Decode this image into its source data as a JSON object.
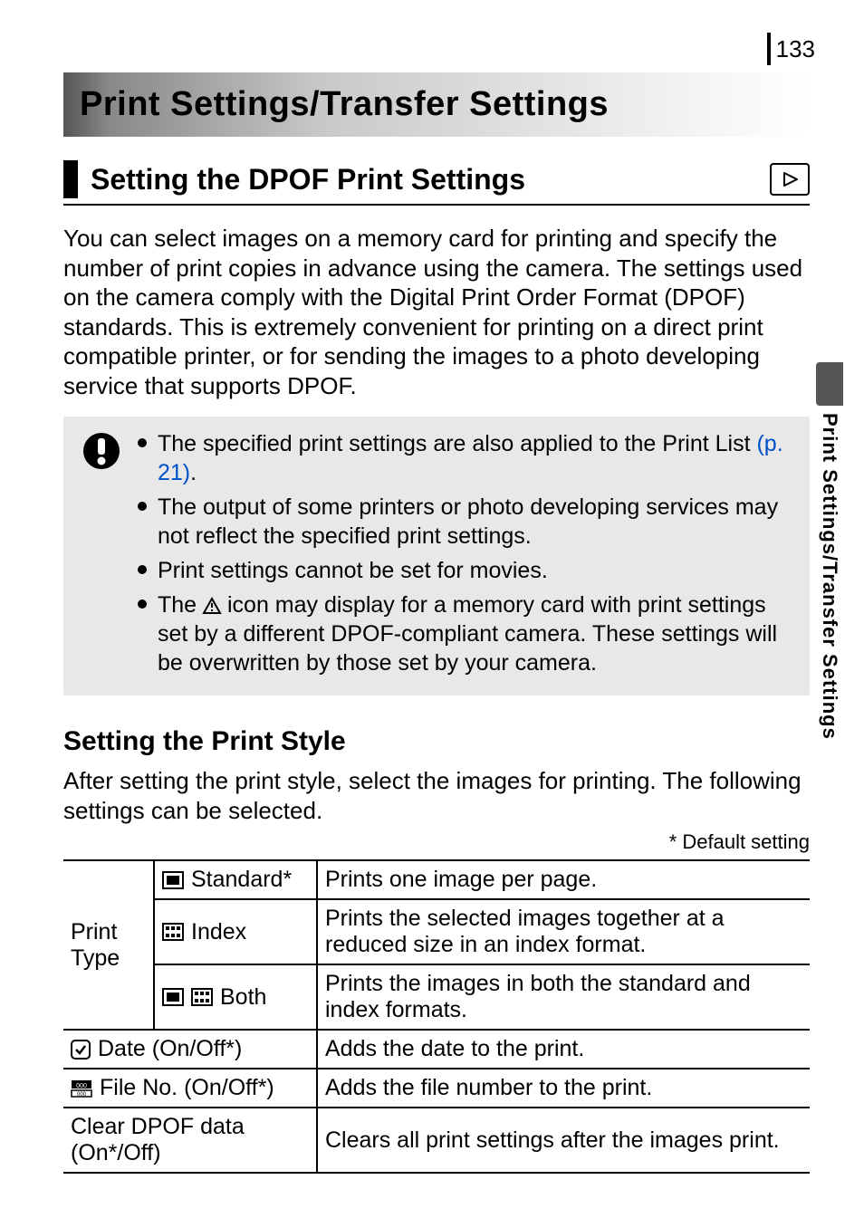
{
  "page_number": "133",
  "chapter_title": "Print Settings/Transfer Settings",
  "section_title": "Setting the DPOF Print Settings",
  "intro_paragraph": "You can select images on a memory card for printing and specify the number of print copies in advance using the camera. The settings used on the camera comply with the Digital Print Order Format (DPOF) standards. This is extremely convenient for printing on a direct print compatible printer, or for sending the images to a photo developing service that supports DPOF.",
  "callout": {
    "items": [
      {
        "prefix": "The specified print settings are also applied to the Print List ",
        "link": "(p. 21)",
        "suffix": "."
      },
      {
        "text": "The output of some printers or photo developing services may not reflect the specified print settings."
      },
      {
        "text": "Print settings cannot be set for movies."
      },
      {
        "prefix": "The ",
        "icon": true,
        "suffix": " icon may display for a memory card with print settings set by a different DPOF-compliant camera. These settings will be overwritten by those set by your camera."
      }
    ]
  },
  "sub_heading": "Setting the Print Style",
  "sub_paragraph": "After setting the print style, select the images for printing. The following settings can be selected.",
  "default_note": "* Default setting",
  "table": {
    "rows": [
      {
        "group": "Print Type",
        "option": "Standard*",
        "desc": "Prints one image per page."
      },
      {
        "group": "",
        "option": "Index",
        "desc": "Prints the selected images together at a reduced size in an index format."
      },
      {
        "group": "",
        "option": "Both",
        "desc": "Prints the images in both the standard and index formats."
      },
      {
        "option": "Date (On/Off*)",
        "desc": "Adds the date to the print."
      },
      {
        "option": "File No. (On/Off*)",
        "desc": "Adds the file number to the print."
      },
      {
        "option": "Clear DPOF data (On*/Off)",
        "desc": "Clears all print settings after the images print."
      }
    ],
    "group_label": "Print Type"
  },
  "side_tab": "Print Settings/Transfer Settings"
}
